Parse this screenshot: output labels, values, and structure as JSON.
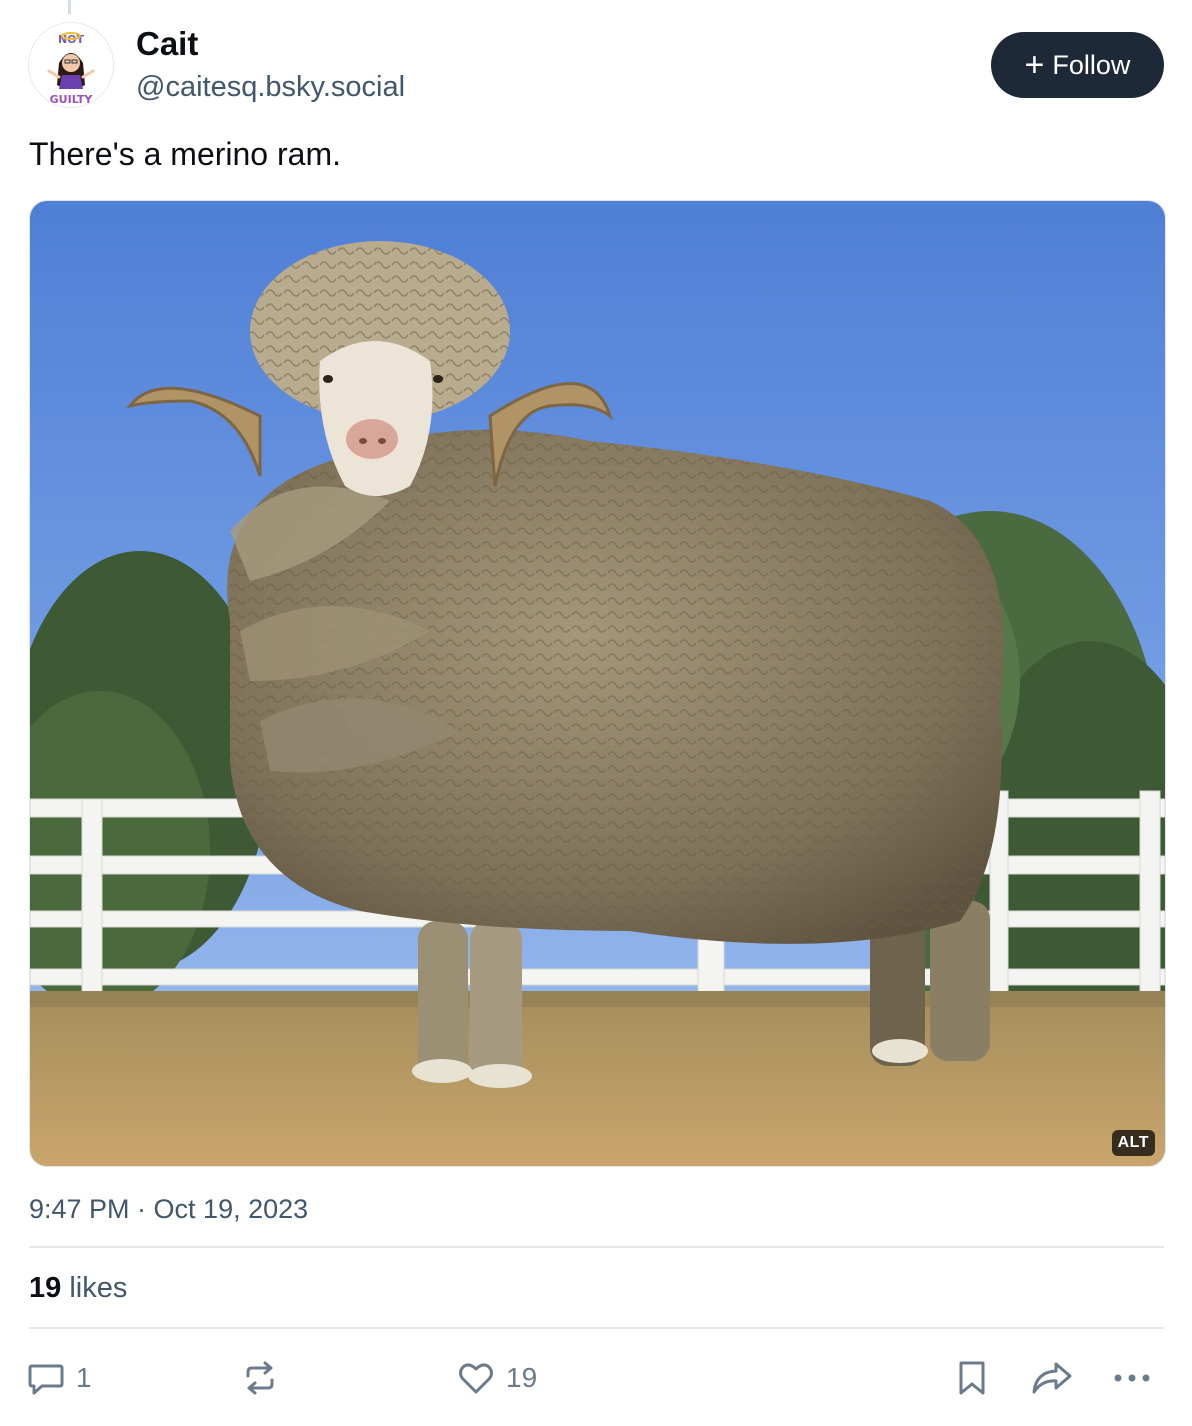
{
  "author": {
    "name": "Cait",
    "handle": "@caitesq.bsky.social",
    "avatar_icon": "not-guilty-avatar",
    "avatar_lettering": "NOT GUILTY"
  },
  "follow_button": {
    "label": "Follow",
    "icon": "plus-icon"
  },
  "post": {
    "text": "There's a merino ram.",
    "image": {
      "description_icon": "merino-ram-photo",
      "alt_badge": "ALT"
    },
    "timestamp": "9:47 PM · Oct 19, 2023"
  },
  "stats": {
    "likes_count": "19",
    "likes_label": "likes"
  },
  "actions": {
    "reply": {
      "icon": "reply-icon",
      "count": "1"
    },
    "repost": {
      "icon": "repost-icon",
      "count": ""
    },
    "like": {
      "icon": "heart-icon",
      "count": "19"
    },
    "bookmark": {
      "icon": "bookmark-icon"
    },
    "share": {
      "icon": "share-icon"
    },
    "more": {
      "icon": "more-icon"
    }
  },
  "colors": {
    "text_primary": "#0b0f14",
    "text_secondary": "#42576c",
    "button_dark": "#1e2937",
    "divider": "#e4e8ed",
    "icon_gray": "#6b7b8c"
  }
}
